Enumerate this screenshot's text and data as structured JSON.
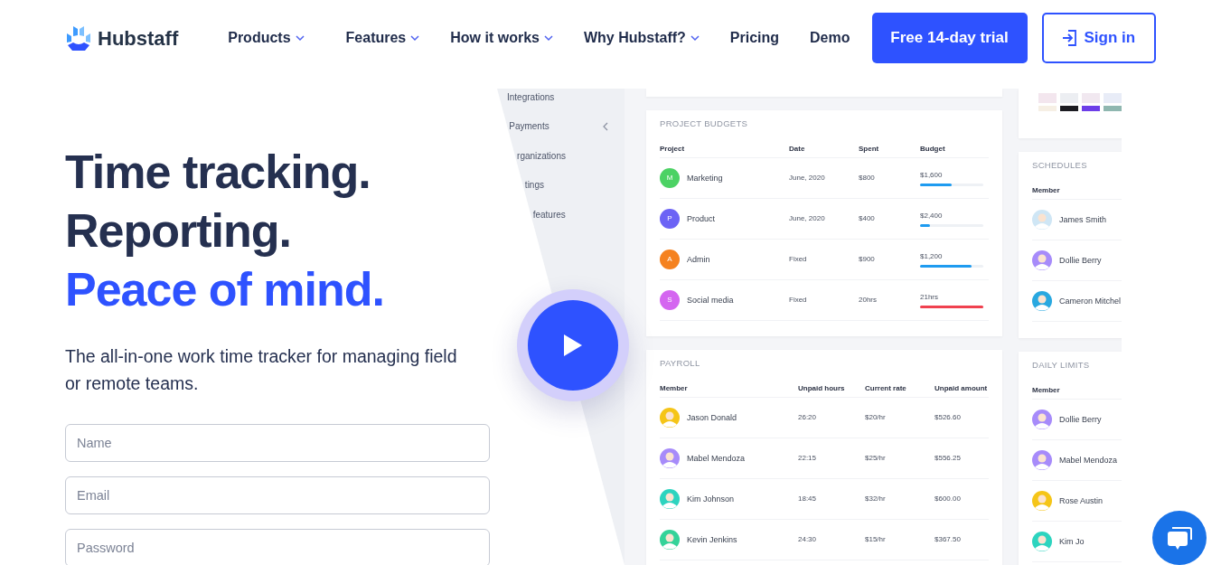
{
  "nav": {
    "logo": "Hubstaff",
    "items": [
      {
        "label": "Products",
        "dropdown": true
      },
      {
        "label": "Features",
        "dropdown": true
      },
      {
        "label": "How it works",
        "dropdown": true
      },
      {
        "label": "Why Hubstaff?",
        "dropdown": true
      },
      {
        "label": "Pricing",
        "dropdown": false
      },
      {
        "label": "Demo",
        "dropdown": false
      }
    ],
    "trial_button": "Free 14-day trial",
    "sign_in_button": "Sign in"
  },
  "hero": {
    "headline": [
      {
        "text": "Time tracking.",
        "kind": "dark"
      },
      {
        "text": "Reporting.",
        "kind": "dark"
      },
      {
        "text": "Peace of mind.",
        "kind": "accent"
      }
    ],
    "subtitle": "The all-in-one work time tracker for managing field or remote teams.",
    "fields": [
      {
        "placeholder": "Name"
      },
      {
        "placeholder": "Email"
      },
      {
        "placeholder": "Password"
      }
    ]
  },
  "dashboard": {
    "sidebar": [
      {
        "label": "Integrations",
        "collapsible": false
      },
      {
        "label": "Payments",
        "collapsible": true
      },
      {
        "label": "rganizations",
        "collapsible": false
      },
      {
        "label": "tings",
        "collapsible": false
      },
      {
        "label": "features",
        "collapsible": false
      }
    ],
    "project_budgets": {
      "title": "PROJECT BUDGETS",
      "columns": [
        "Project",
        "Date",
        "Spent",
        "Budget"
      ],
      "rows": [
        {
          "initial": "M",
          "name": "Marketing",
          "date": "June, 2020",
          "spent": "$800",
          "budget": "$1,600",
          "level": 0.5,
          "over": false,
          "color": "#4cd264"
        },
        {
          "initial": "P",
          "name": "Product",
          "date": "June, 2020",
          "spent": "$400",
          "budget": "$2,400",
          "level": 0.16,
          "over": false,
          "color": "#6c63f5"
        },
        {
          "initial": "A",
          "name": "Admin",
          "date": "Fixed",
          "spent": "$900",
          "budget": "$1,200",
          "level": 0.82,
          "over": false,
          "color": "#f5821f"
        },
        {
          "initial": "S",
          "name": "Social media",
          "date": "Fixed",
          "spent": "20hrs",
          "budget": "21hrs",
          "level": 1,
          "over": true,
          "color": "#d466f0"
        }
      ]
    },
    "payroll": {
      "title": "PAYROLL",
      "columns": [
        "Member",
        "Unpaid hours",
        "Current rate",
        "Unpaid amount"
      ],
      "rows": [
        {
          "name": "Jason Donald",
          "hours": "26:20",
          "rate": "$20/hr",
          "amount": "$526.60",
          "color": "#f5c518"
        },
        {
          "name": "Mabel Mendoza",
          "hours": "22:15",
          "rate": "$25/hr",
          "amount": "$556.25",
          "color": "#a78bfa"
        },
        {
          "name": "Kim Johnson",
          "hours": "18:45",
          "rate": "$32/hr",
          "amount": "$600.00",
          "color": "#2dd4bf"
        },
        {
          "name": "Kevin Jenkins",
          "hours": "24:30",
          "rate": "$15/hr",
          "amount": "$367.50",
          "color": "#34d399"
        }
      ]
    },
    "schedules": {
      "title": "SCHEDULES",
      "columns": [
        "Member"
      ],
      "rows": [
        {
          "name": "James Smith",
          "color": "#cfe6f5"
        },
        {
          "name": "Dollie Berry",
          "color": "#a78bfa"
        },
        {
          "name": "Cameron Mitchel",
          "color": "#29a8e0"
        }
      ]
    },
    "daily_limits": {
      "title": "DAILY LIMITS",
      "columns": [
        "Member"
      ],
      "rows": [
        {
          "name": "Dollie Berry",
          "color": "#a78bfa"
        },
        {
          "name": "Mabel Mendoza",
          "color": "#a78bfa"
        },
        {
          "name": "Rose Austin",
          "color": "#f5c518"
        },
        {
          "name": "Kim Jo",
          "color": "#2dd4bf"
        }
      ]
    }
  }
}
